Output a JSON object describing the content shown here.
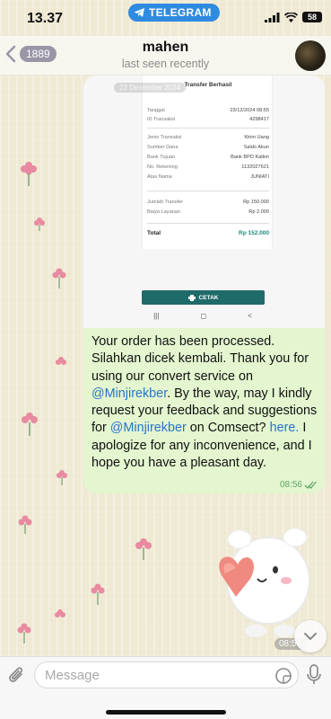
{
  "status_bar": {
    "time": "13.37",
    "app_pill": "TELEGRAM",
    "battery": "58"
  },
  "header": {
    "back_count": "1889",
    "chat_name": "mahen",
    "chat_status": "last seen recently"
  },
  "message": {
    "screenshot": {
      "date_chip": "23 Desember 2024",
      "receipt_title": "Transfer Berhasil",
      "rows": [
        {
          "label": "Tanggal",
          "value": "23/12/2024 08:55"
        },
        {
          "label": "ID Transaksi",
          "value": "4298417"
        },
        {
          "label": "Jenis Transaksi",
          "value": "Kirim Uang"
        },
        {
          "label": "Sumber Dana",
          "value": "Saldo Akun"
        },
        {
          "label": "Bank Tujuan",
          "value": "Bank BPD Kaltim"
        },
        {
          "label": "No. Rekening",
          "value": "1132027621"
        },
        {
          "label": "Atas Nama",
          "value": "JUNIATI"
        },
        {
          "label": "Jumlah Transfer",
          "value": "Rp 150.000"
        },
        {
          "label": "Biaya Layanan",
          "value": "Rp 2.000"
        }
      ],
      "total_label": "Total",
      "total_value": "Rp 152.000",
      "cetak_label": "CETAK"
    },
    "text_parts": {
      "p1": "Your order has been processed. Silahkan dicek kembali. Thank you for using our convert service on ",
      "mention1": "@Minjirekber",
      "p2": ". By the way, may I kindly request your feedback and suggestions for ",
      "mention2": "@Minjirekber",
      "p3": " on Comsect? ",
      "link": "here.",
      "p4": " I apologize for any inconvenience, and I hope you have a pleasant day."
    },
    "time": "08:56"
  },
  "sticker": {
    "time": "08:56"
  },
  "input": {
    "placeholder": "Message"
  },
  "colors": {
    "bubble": "#e3f6cf",
    "link": "#2b75c9",
    "pill": "#2f8be0",
    "cetak": "#1f6b6a"
  }
}
